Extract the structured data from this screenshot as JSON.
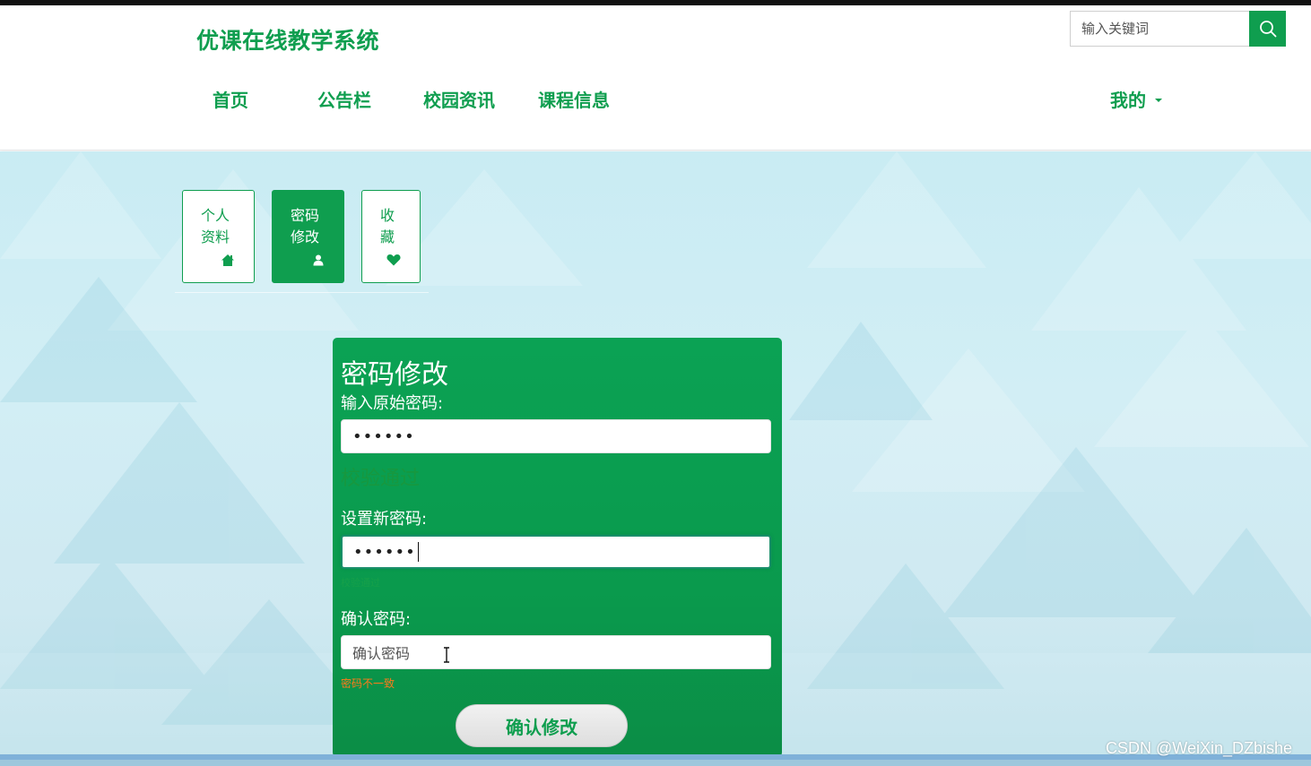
{
  "site": {
    "title": "优课在线教学系统"
  },
  "search": {
    "placeholder": "输入关键词"
  },
  "nav": {
    "items": [
      "首页",
      "公告栏",
      "校园资讯",
      "课程信息"
    ],
    "me_label": "我的"
  },
  "tabs": [
    {
      "line1": "个人",
      "line2": "资料",
      "icon": "home-icon",
      "active": false
    },
    {
      "line1": "密码",
      "line2": "修改",
      "icon": "user-icon",
      "active": true
    },
    {
      "line1": "收",
      "line2": "藏",
      "icon": "heart-icon",
      "active": false
    }
  ],
  "form": {
    "title": "密码修改",
    "old_password": {
      "label": "输入原始密码:",
      "value": "••••••",
      "status": "校验通过"
    },
    "new_password": {
      "label": "设置新密码:",
      "value": "••••••",
      "status": "校验通过"
    },
    "confirm_password": {
      "label": "确认密码:",
      "placeholder": "确认密码",
      "status": "密码不一致"
    },
    "submit_label": "确认修改"
  },
  "watermark": "CSDN @WeiXin_DZbishe",
  "colors": {
    "brand_green": "#0f9e4f",
    "panel_green": "#0b9d4e",
    "error_orange": "#ff7a1a"
  }
}
